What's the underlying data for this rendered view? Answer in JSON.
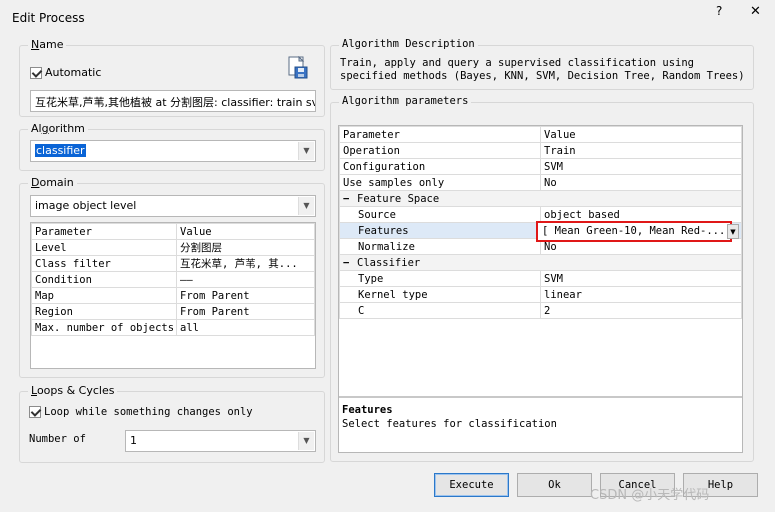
{
  "window": {
    "title": "Edit Process",
    "help": "?",
    "close": "✕"
  },
  "name_group": {
    "legend_u": "N",
    "legend_rest": "ame",
    "automatic_label": "Automatic",
    "name_value": "互花米草,芦苇,其他植被 at 分割图层: classifier: train sv"
  },
  "algorithm_group": {
    "legend_pre": "Al",
    "legend_u": "g",
    "legend_rest": "orithm",
    "selected": "classifier"
  },
  "domain_group": {
    "legend_u": "D",
    "legend_rest": "omain",
    "selected": "image object level",
    "columns": [
      "Parameter",
      "Value"
    ],
    "rows": [
      [
        "Level",
        "分割图层"
      ],
      [
        "Class filter",
        "互花米草, 芦苇, 其..."
      ],
      [
        "Condition",
        "——"
      ],
      [
        "Map",
        "From Parent"
      ],
      [
        "Region",
        "From Parent"
      ],
      [
        "Max. number of objects",
        "all"
      ]
    ]
  },
  "loops_group": {
    "legend_u": "L",
    "legend_rest": "oops & Cycles",
    "loop_label": "Loop while something changes only",
    "number_label": "Number of",
    "number_value": "1"
  },
  "description_group": {
    "legend": "Algorithm Description",
    "text": "Train, apply and query a supervised classification using specified methods (Bayes, KNN, SVM, Decision Tree, Random Trees)"
  },
  "params_group": {
    "legend": "Algorithm parameters",
    "columns": [
      "Parameter",
      "Value"
    ],
    "rows_top": [
      [
        "Operation",
        "Train"
      ],
      [
        "Configuration",
        "SVM"
      ],
      [
        "Use samples only",
        "No"
      ]
    ],
    "section_feature": "Feature Space",
    "rows_feature": [
      [
        "Source",
        "object based"
      ],
      [
        "Features",
        "[ Mean Green-10, Mean Red-..."
      ],
      [
        "Normalize",
        "No"
      ]
    ],
    "section_classifier": "Classifier",
    "rows_classifier": [
      [
        "Type",
        "SVM"
      ],
      [
        "Kernel type",
        "linear"
      ],
      [
        "C",
        "2"
      ]
    ],
    "help_title": "Features",
    "help_text": "Select features for classification"
  },
  "buttons": {
    "execute": "Execute",
    "ok": "Ok",
    "cancel": "Cancel",
    "help": "Help"
  },
  "watermark": "CSDN @小天学代码"
}
